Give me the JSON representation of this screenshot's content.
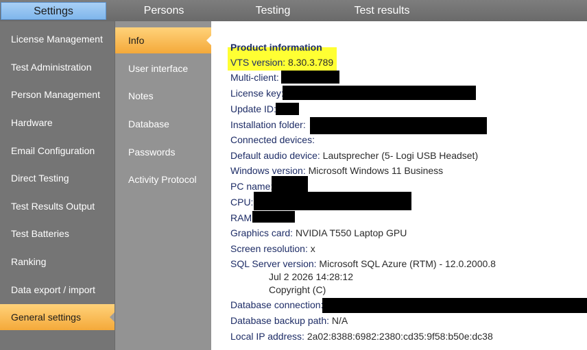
{
  "top_tabs": [
    {
      "label": "Settings"
    },
    {
      "label": "Persons"
    },
    {
      "label": "Testing"
    },
    {
      "label": "Test results"
    }
  ],
  "left_nav": [
    {
      "label": "License Management"
    },
    {
      "label": "Test Administration"
    },
    {
      "label": "Person Management"
    },
    {
      "label": "Hardware"
    },
    {
      "label": "Email Configuration"
    },
    {
      "label": "Direct Testing"
    },
    {
      "label": "Test Results Output"
    },
    {
      "label": "Test Batteries"
    },
    {
      "label": "Ranking"
    },
    {
      "label": "Data export / import"
    },
    {
      "label": "General settings"
    }
  ],
  "sub_nav": [
    {
      "label": "Info"
    },
    {
      "label": "User interface"
    },
    {
      "label": "Notes"
    },
    {
      "label": "Database"
    },
    {
      "label": "Passwords"
    },
    {
      "label": "Activity Protocol"
    }
  ],
  "info": {
    "heading": "Product information",
    "vts_version_label": "VTS version:",
    "vts_version_value": "8.30.3.789",
    "multi_client_label": "Multi-client:",
    "license_key_label": "License key:",
    "update_id_label": "Update ID:",
    "installation_folder_label": "Installation folder:",
    "connected_devices_label": "Connected devices:",
    "audio_label": "Default audio device:",
    "audio_value": "Lautsprecher (5- Logi USB Headset)",
    "windows_label": "Windows version:",
    "windows_value": "Microsoft Windows 11 Business",
    "pc_name_label": "PC name:",
    "cpu_label": "CPU:",
    "ram_label": "RAM:",
    "graphics_label": "Graphics card:",
    "graphics_value": "NVIDIA T550 Laptop GPU",
    "resolution_label": "Screen resolution:",
    "resolution_value": "x",
    "sql_label": "SQL Server version:",
    "sql_value": "Microsoft SQL Azure (RTM) - 12.0.2000.8",
    "sql_date": "Jul  2 2026 14:28:12",
    "sql_copyright": "Copyright (C)",
    "db_connection_label": "Database connection:",
    "db_backup_label": "Database backup path:",
    "db_backup_value": "N/A",
    "local_ip_label": "Local IP address:",
    "local_ip_value": "2a02:8388:6982:2380:cd35:9f58:b50e:dc38"
  },
  "colors": {
    "active_tab": "#7fb6ec",
    "active_nav": "#f4a93a",
    "highlight": "#ffff33",
    "label_text": "#1d2c66"
  }
}
